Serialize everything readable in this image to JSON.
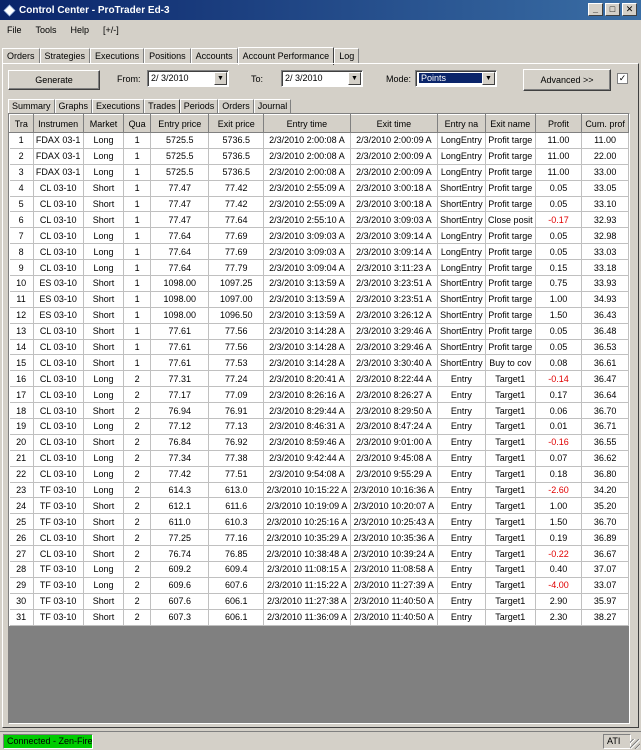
{
  "window": {
    "title": "Control Center - ProTrader Ed-3",
    "minimize": "_",
    "maximize": "□",
    "close": "✕"
  },
  "menu": [
    "File",
    "Tools",
    "Help",
    "[+/-]"
  ],
  "main_tabs": [
    "Orders",
    "Strategies",
    "Executions",
    "Positions",
    "Accounts",
    "Account Performance",
    "Log"
  ],
  "toolbar": {
    "generate": "Generate",
    "from_label": "From:",
    "from_value": "2/  3/2010",
    "to_label": "To:",
    "to_value": "2/  3/2010",
    "mode_label": "Mode:",
    "mode_value": "Points",
    "advanced": "Advanced >>",
    "checkbox_checked": true
  },
  "sub_tabs": [
    "Summary",
    "Graphs",
    "Executions",
    "Trades",
    "Periods",
    "Orders",
    "Journal"
  ],
  "table": {
    "columns": [
      "Tra",
      "Instrumen",
      "Market",
      "Qua",
      "Entry price",
      "Exit price",
      "Entry time",
      "Exit time",
      "Entry na",
      "Exit name",
      "Profit",
      "Cum. prof"
    ],
    "rows": [
      [
        "1",
        "FDAX 03-1",
        "Long",
        "1",
        "5725.5",
        "5736.5",
        "2/3/2010 2:00:08 A",
        "2/3/2010 2:00:09 A",
        "LongEntry",
        "Profit targe",
        "11.00",
        "11.00"
      ],
      [
        "2",
        "FDAX 03-1",
        "Long",
        "1",
        "5725.5",
        "5736.5",
        "2/3/2010 2:00:08 A",
        "2/3/2010 2:00:09 A",
        "LongEntry",
        "Profit targe",
        "11.00",
        "22.00"
      ],
      [
        "3",
        "FDAX 03-1",
        "Long",
        "1",
        "5725.5",
        "5736.5",
        "2/3/2010 2:00:08 A",
        "2/3/2010 2:00:09 A",
        "LongEntry",
        "Profit targe",
        "11.00",
        "33.00"
      ],
      [
        "4",
        "CL 03-10",
        "Short",
        "1",
        "77.47",
        "77.42",
        "2/3/2010 2:55:09 A",
        "2/3/2010 3:00:18 A",
        "ShortEntry",
        "Profit targe",
        "0.05",
        "33.05"
      ],
      [
        "5",
        "CL 03-10",
        "Short",
        "1",
        "77.47",
        "77.42",
        "2/3/2010 2:55:09 A",
        "2/3/2010 3:00:18 A",
        "ShortEntry",
        "Profit targe",
        "0.05",
        "33.10"
      ],
      [
        "6",
        "CL 03-10",
        "Short",
        "1",
        "77.47",
        "77.64",
        "2/3/2010 2:55:10 A",
        "2/3/2010 3:09:03 A",
        "ShortEntry",
        "Close posit",
        "-0.17",
        "32.93"
      ],
      [
        "7",
        "CL 03-10",
        "Long",
        "1",
        "77.64",
        "77.69",
        "2/3/2010 3:09:03 A",
        "2/3/2010 3:09:14 A",
        "LongEntry",
        "Profit targe",
        "0.05",
        "32.98"
      ],
      [
        "8",
        "CL 03-10",
        "Long",
        "1",
        "77.64",
        "77.69",
        "2/3/2010 3:09:03 A",
        "2/3/2010 3:09:14 A",
        "LongEntry",
        "Profit targe",
        "0.05",
        "33.03"
      ],
      [
        "9",
        "CL 03-10",
        "Long",
        "1",
        "77.64",
        "77.79",
        "2/3/2010 3:09:04 A",
        "2/3/2010 3:11:23 A",
        "LongEntry",
        "Profit targe",
        "0.15",
        "33.18"
      ],
      [
        "10",
        "ES 03-10",
        "Short",
        "1",
        "1098.00",
        "1097.25",
        "2/3/2010 3:13:59 A",
        "2/3/2010 3:23:51 A",
        "ShortEntry",
        "Profit targe",
        "0.75",
        "33.93"
      ],
      [
        "11",
        "ES 03-10",
        "Short",
        "1",
        "1098.00",
        "1097.00",
        "2/3/2010 3:13:59 A",
        "2/3/2010 3:23:51 A",
        "ShortEntry",
        "Profit targe",
        "1.00",
        "34.93"
      ],
      [
        "12",
        "ES 03-10",
        "Short",
        "1",
        "1098.00",
        "1096.50",
        "2/3/2010 3:13:59 A",
        "2/3/2010 3:26:12 A",
        "ShortEntry",
        "Profit targe",
        "1.50",
        "36.43"
      ],
      [
        "13",
        "CL 03-10",
        "Short",
        "1",
        "77.61",
        "77.56",
        "2/3/2010 3:14:28 A",
        "2/3/2010 3:29:46 A",
        "ShortEntry",
        "Profit targe",
        "0.05",
        "36.48"
      ],
      [
        "14",
        "CL 03-10",
        "Short",
        "1",
        "77.61",
        "77.56",
        "2/3/2010 3:14:28 A",
        "2/3/2010 3:29:46 A",
        "ShortEntry",
        "Profit targe",
        "0.05",
        "36.53"
      ],
      [
        "15",
        "CL 03-10",
        "Short",
        "1",
        "77.61",
        "77.53",
        "2/3/2010 3:14:28 A",
        "2/3/2010 3:30:40 A",
        "ShortEntry",
        "Buy to cov",
        "0.08",
        "36.61"
      ],
      [
        "16",
        "CL 03-10",
        "Long",
        "2",
        "77.31",
        "77.24",
        "2/3/2010 8:20:41 A",
        "2/3/2010 8:22:44 A",
        "Entry",
        "Target1",
        "-0.14",
        "36.47"
      ],
      [
        "17",
        "CL 03-10",
        "Long",
        "2",
        "77.17",
        "77.09",
        "2/3/2010 8:26:16 A",
        "2/3/2010 8:26:27 A",
        "Entry",
        "Target1",
        "0.17",
        "36.64"
      ],
      [
        "18",
        "CL 03-10",
        "Short",
        "2",
        "76.94",
        "76.91",
        "2/3/2010 8:29:44 A",
        "2/3/2010 8:29:50 A",
        "Entry",
        "Target1",
        "0.06",
        "36.70"
      ],
      [
        "19",
        "CL 03-10",
        "Long",
        "2",
        "77.12",
        "77.13",
        "2/3/2010 8:46:31 A",
        "2/3/2010 8:47:24 A",
        "Entry",
        "Target1",
        "0.01",
        "36.71"
      ],
      [
        "20",
        "CL 03-10",
        "Short",
        "2",
        "76.84",
        "76.92",
        "2/3/2010 8:59:46 A",
        "2/3/2010 9:01:00 A",
        "Entry",
        "Target1",
        "-0.16",
        "36.55"
      ],
      [
        "21",
        "CL 03-10",
        "Long",
        "2",
        "77.34",
        "77.38",
        "2/3/2010 9:42:44 A",
        "2/3/2010 9:45:08 A",
        "Entry",
        "Target1",
        "0.07",
        "36.62"
      ],
      [
        "22",
        "CL 03-10",
        "Long",
        "2",
        "77.42",
        "77.51",
        "2/3/2010 9:54:08 A",
        "2/3/2010 9:55:29 A",
        "Entry",
        "Target1",
        "0.18",
        "36.80"
      ],
      [
        "23",
        "TF 03-10",
        "Long",
        "2",
        "614.3",
        "613.0",
        "2/3/2010 10:15:22 A",
        "2/3/2010 10:16:36 A",
        "Entry",
        "Target1",
        "-2.60",
        "34.20"
      ],
      [
        "24",
        "TF 03-10",
        "Short",
        "2",
        "612.1",
        "611.6",
        "2/3/2010 10:19:09 A",
        "2/3/2010 10:20:07 A",
        "Entry",
        "Target1",
        "1.00",
        "35.20"
      ],
      [
        "25",
        "TF 03-10",
        "Short",
        "2",
        "611.0",
        "610.3",
        "2/3/2010 10:25:16 A",
        "2/3/2010 10:25:43 A",
        "Entry",
        "Target1",
        "1.50",
        "36.70"
      ],
      [
        "26",
        "CL 03-10",
        "Short",
        "2",
        "77.25",
        "77.16",
        "2/3/2010 10:35:29 A",
        "2/3/2010 10:35:36 A",
        "Entry",
        "Target1",
        "0.19",
        "36.89"
      ],
      [
        "27",
        "CL 03-10",
        "Short",
        "2",
        "76.74",
        "76.85",
        "2/3/2010 10:38:48 A",
        "2/3/2010 10:39:24 A",
        "Entry",
        "Target1",
        "-0.22",
        "36.67"
      ],
      [
        "28",
        "TF 03-10",
        "Long",
        "2",
        "609.2",
        "609.4",
        "2/3/2010 11:08:15 A",
        "2/3/2010 11:08:58 A",
        "Entry",
        "Target1",
        "0.40",
        "37.07"
      ],
      [
        "29",
        "TF 03-10",
        "Long",
        "2",
        "609.6",
        "607.6",
        "2/3/2010 11:15:22 A",
        "2/3/2010 11:27:39 A",
        "Entry",
        "Target1",
        "-4.00",
        "33.07"
      ],
      [
        "30",
        "TF 03-10",
        "Short",
        "2",
        "607.6",
        "606.1",
        "2/3/2010 11:27:38 A",
        "2/3/2010 11:40:50 A",
        "Entry",
        "Target1",
        "2.90",
        "35.97"
      ],
      [
        "31",
        "TF 03-10",
        "Short",
        "2",
        "607.3",
        "606.1",
        "2/3/2010 11:36:09 A",
        "2/3/2010 11:40:50 A",
        "Entry",
        "Target1",
        "2.30",
        "38.27"
      ]
    ]
  },
  "status": {
    "connection": "Connected - Zen-Fire",
    "ati": "ATI"
  },
  "colors": {
    "negative": "#e00000",
    "connected": "#00cc00",
    "title_bg": "#0a246a"
  }
}
